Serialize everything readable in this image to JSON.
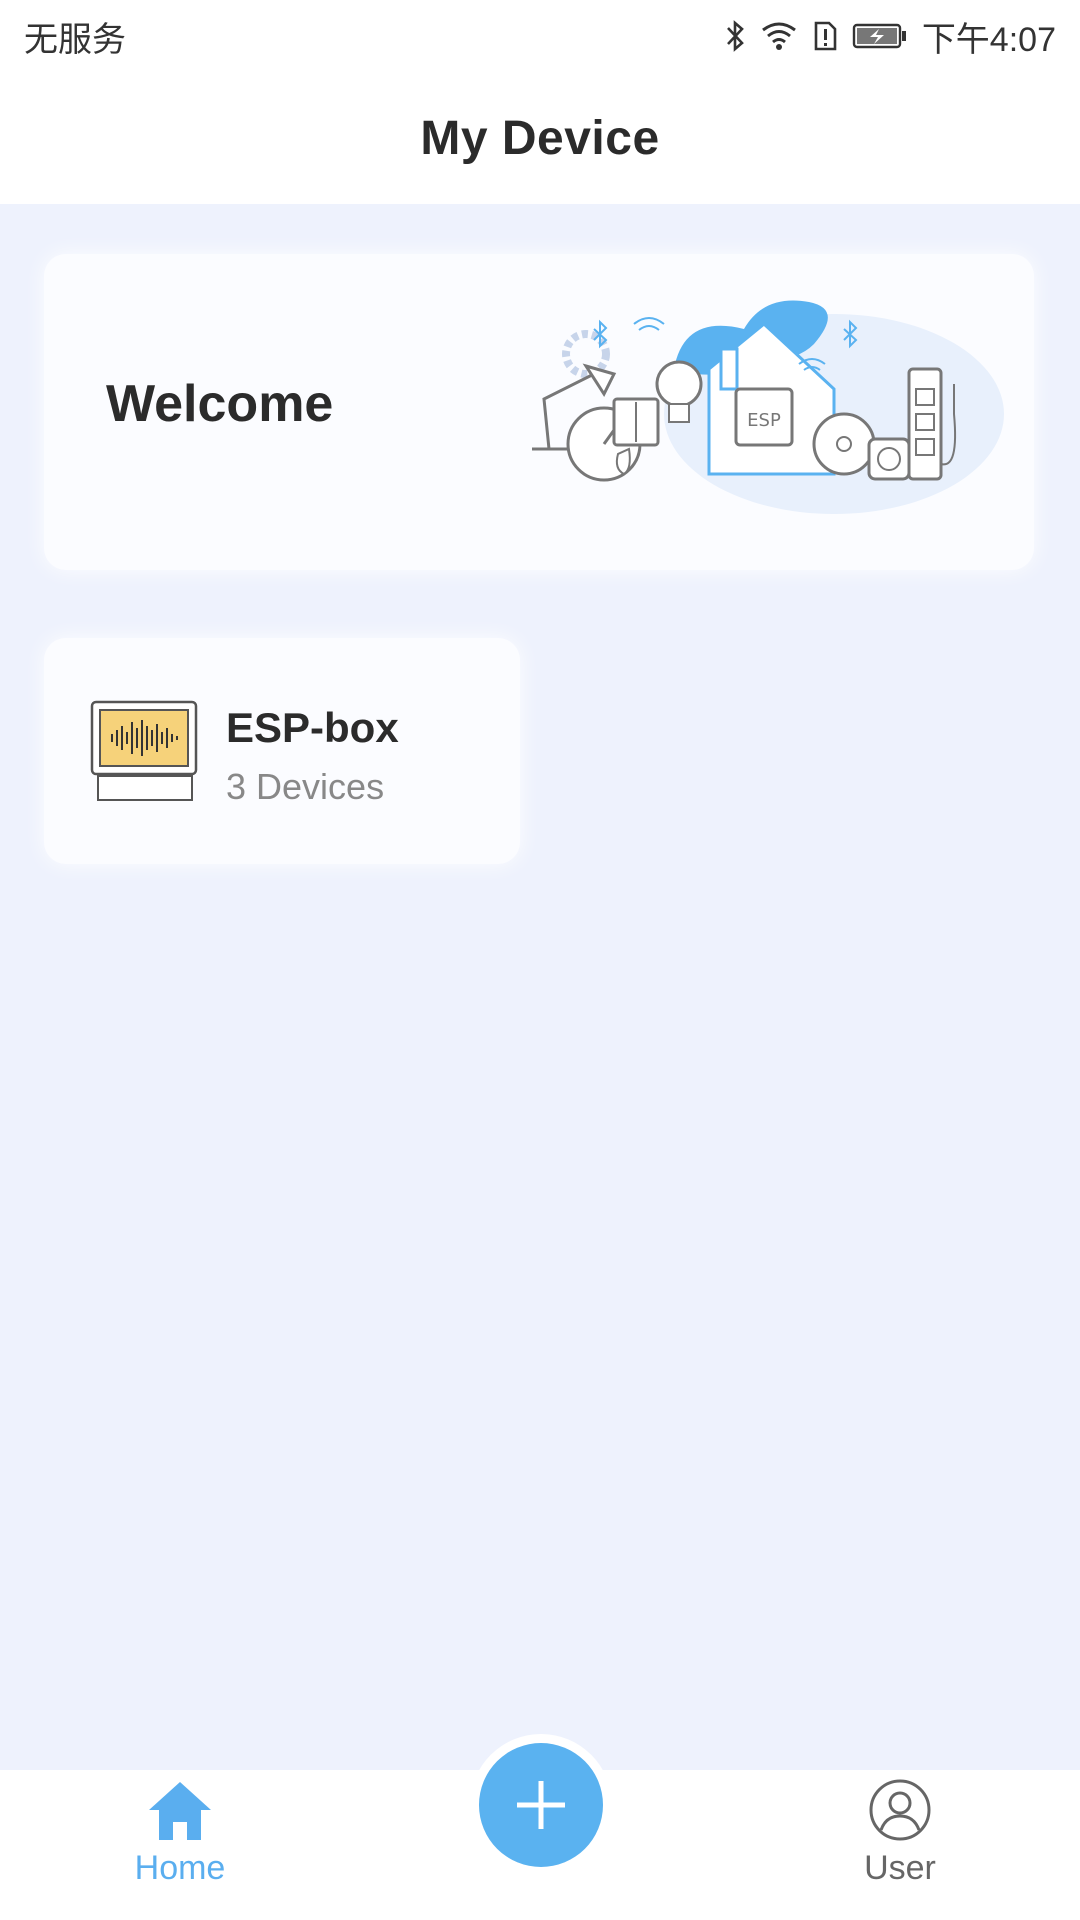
{
  "status_bar": {
    "carrier": "无服务",
    "time": "下午4:07",
    "icons": [
      "bluetooth-icon",
      "wifi-icon",
      "alert-icon",
      "battery-charging-icon"
    ]
  },
  "header": {
    "title": "My Device"
  },
  "welcome_card": {
    "text": "Welcome",
    "illustration": "smart-home-illustration"
  },
  "devices": [
    {
      "name": "ESP-box",
      "count": "3 Devices",
      "icon": "esp-box-device-image"
    }
  ],
  "bottom_nav": {
    "home_label": "Home",
    "user_label": "User",
    "add_icon": "plus-icon"
  },
  "colors": {
    "accent": "#5ab2f0",
    "background": "#eef2fd",
    "card": "#fbfcff",
    "title_text": "#2b2b2b",
    "secondary_text": "#888888"
  }
}
